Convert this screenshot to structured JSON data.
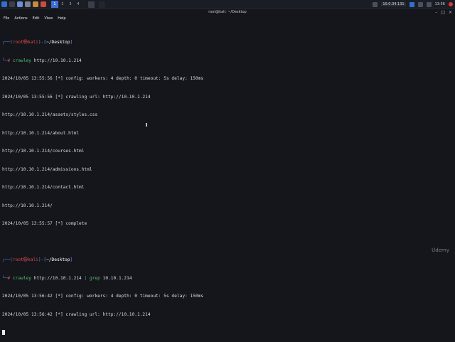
{
  "taskbar": {
    "workspaces": [
      "1",
      "2",
      "3",
      "4"
    ],
    "active_workspace": "1",
    "ip": "10.0.34.131",
    "clock": "13:56"
  },
  "window": {
    "title": "root@kali: ~/Desktop",
    "controls": [
      "–",
      "□",
      "×"
    ]
  },
  "menubar": {
    "items": [
      "File",
      "Actions",
      "Edit",
      "View",
      "Help"
    ]
  },
  "terminal": {
    "prompt1": {
      "user": "root㉿kali",
      "path": "~/Desktop",
      "command": "crawley",
      "args": " http://10.10.1.214"
    },
    "output1": [
      "2024/10/05 13:55:56 [*] config: workers: 4 depth: 0 timeout: 5s delay: 150ms",
      "2024/10/05 13:55:56 [*] crawling url: http://10.10.1.214",
      "http://10.10.1.214/assets/styles.css",
      "http://10.10.1.214/about.html",
      "http://10.10.1.214/courses.html",
      "http://10.10.1.214/admissions.html",
      "http://10.10.1.214/contact.html",
      "http://10.10.1.214/",
      "2024/10/05 13:55:57 [*] complete"
    ],
    "prompt2": {
      "user": "root㉿kali",
      "path": "~/Desktop",
      "command": "crawley",
      "args": " http://10.10.1.214 ",
      "pipe": "|",
      "pipe_cmd": " grep",
      "pipe_args": " 10.10.1.214"
    },
    "output2": [
      "2024/10/05 13:56:42 [*] config: workers: 4 depth: 0 timeout: 5s delay: 150ms",
      "2024/10/05 13:56:42 [*] crawling url: http://10.10.1.214"
    ]
  },
  "watermark": "Údemy"
}
